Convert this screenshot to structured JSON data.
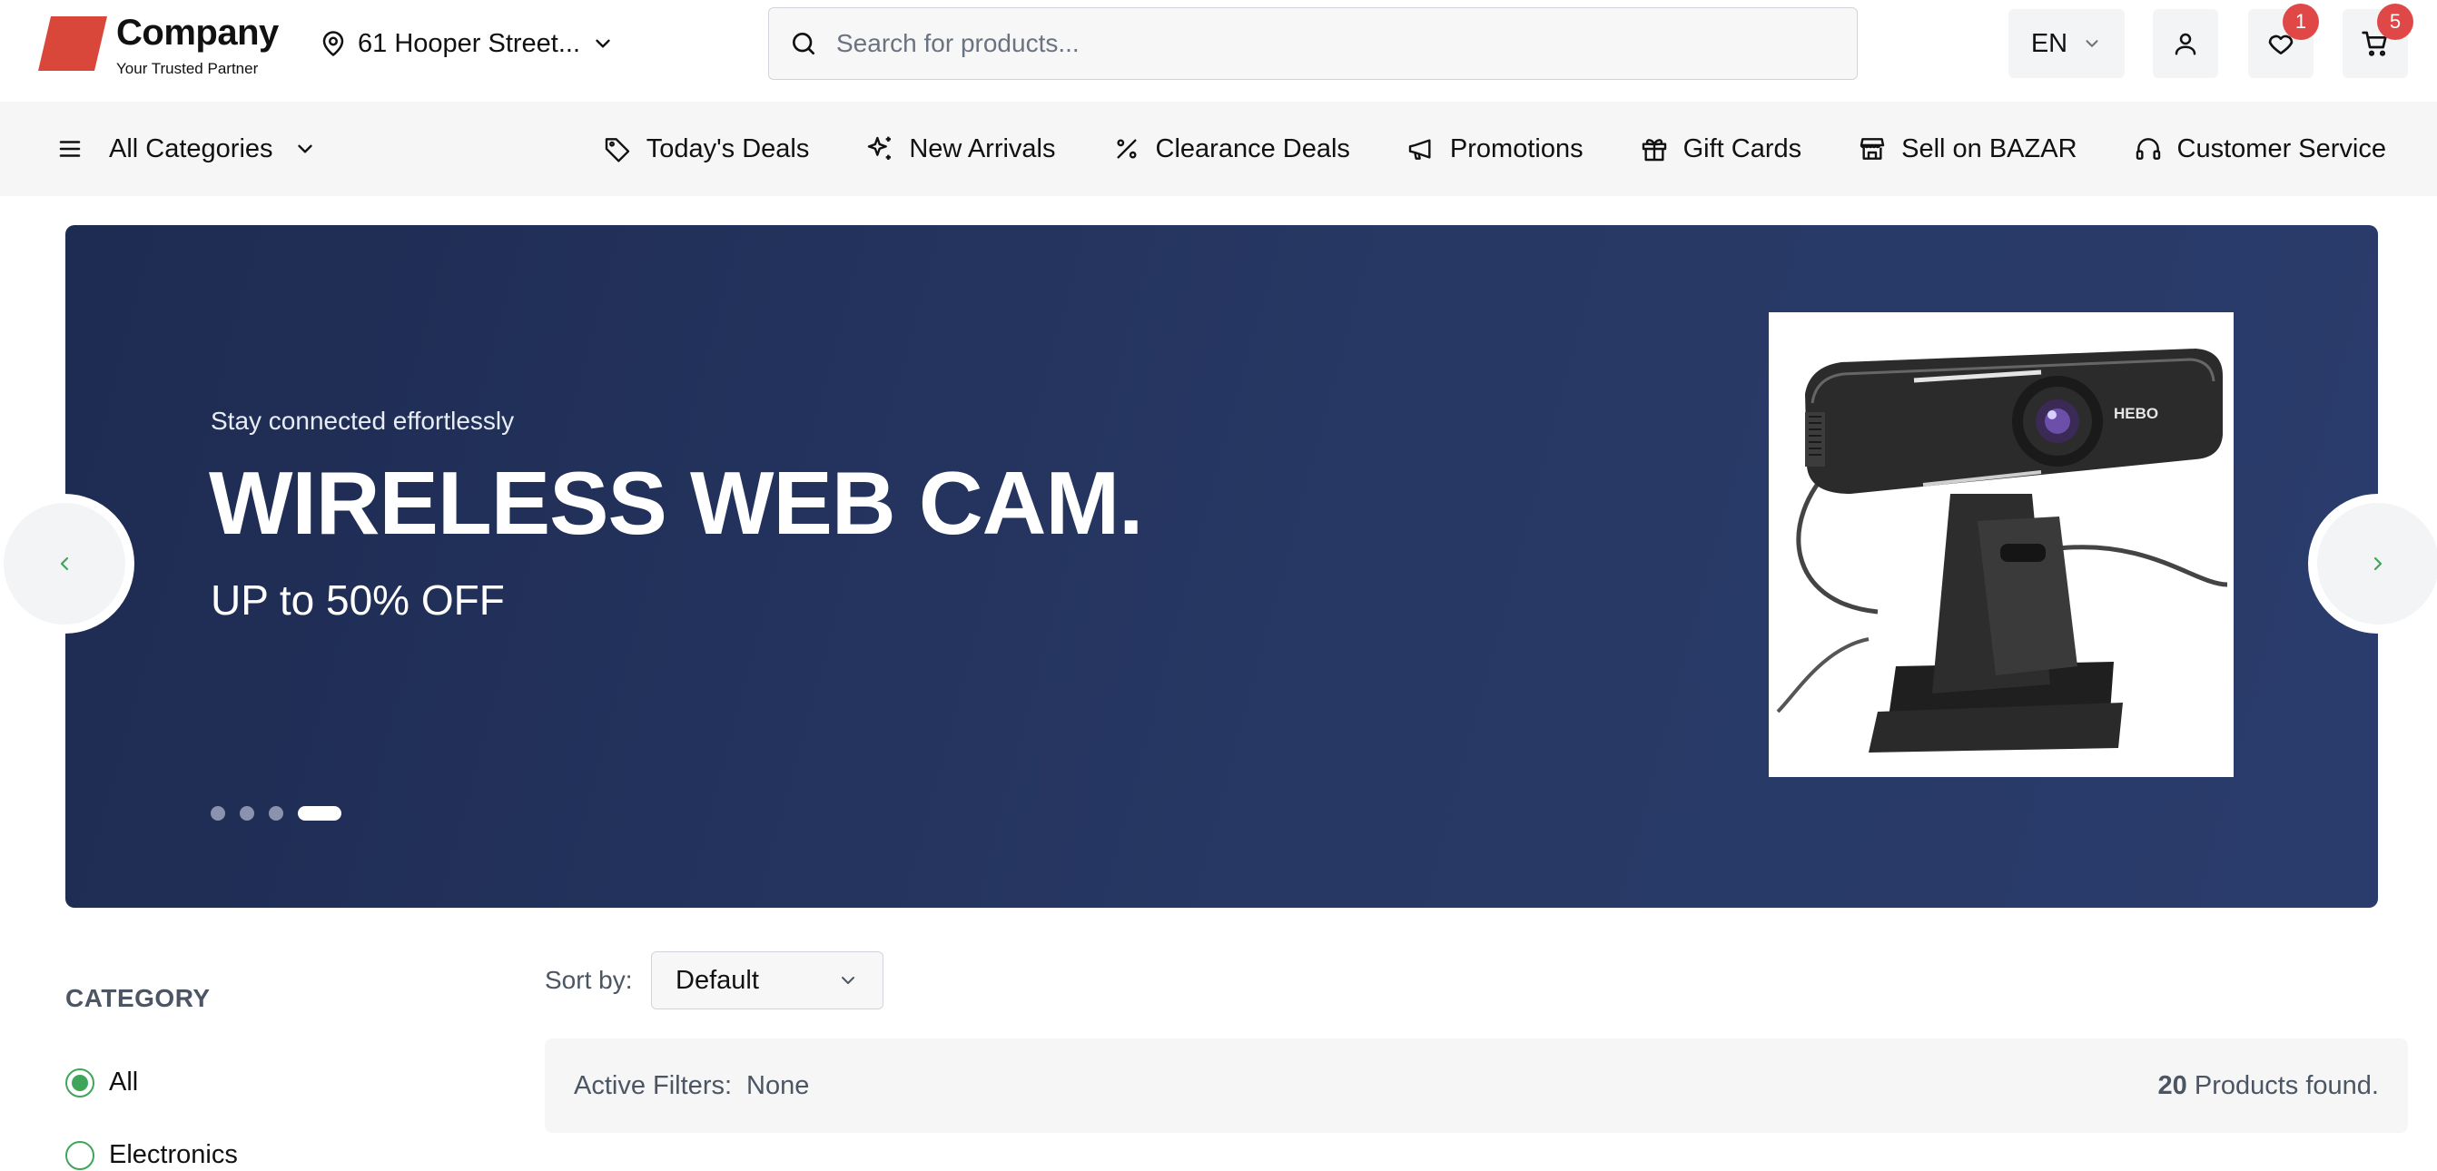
{
  "brand": {
    "name": "Company",
    "tagline": "Your Trusted Partner",
    "color": "#d9473a"
  },
  "header": {
    "location": "61 Hooper Street...",
    "search_placeholder": "Search for products...",
    "language": "EN",
    "wishlist_count": "1",
    "cart_count": "5"
  },
  "nav": {
    "all_categories": "All Categories",
    "links": [
      {
        "label": "Today's Deals",
        "icon": "tag-icon"
      },
      {
        "label": "New Arrivals",
        "icon": "sparkles-icon"
      },
      {
        "label": "Clearance Deals",
        "icon": "percent-icon"
      },
      {
        "label": "Promotions",
        "icon": "megaphone-icon"
      },
      {
        "label": "Gift Cards",
        "icon": "gift-icon"
      },
      {
        "label": "Sell on BAZAR",
        "icon": "store-icon"
      },
      {
        "label": "Customer Service",
        "icon": "headset-icon"
      }
    ]
  },
  "hero": {
    "subtitle": "Stay connected effortlessly",
    "title": "WIRELESS WEB CAM.",
    "offer": "UP to 50% OFF",
    "slide_count": 4,
    "active_slide": 4,
    "product_brand_text": "HEBO",
    "background": "#243462",
    "arrow_color": "#3fa55b"
  },
  "filters": {
    "category_title": "CATEGORY",
    "options": [
      {
        "label": "All",
        "selected": true
      },
      {
        "label": "Electronics",
        "selected": false
      }
    ],
    "accent": "#3fa55b"
  },
  "results": {
    "sort_label": "Sort by:",
    "sort_value": "Default",
    "active_filters_label": "Active Filters:",
    "active_filters_value": "None",
    "count": "20",
    "count_suffix": "Products found."
  }
}
